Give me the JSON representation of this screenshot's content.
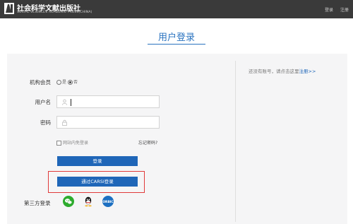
{
  "header": {
    "brand_name": "社会科学文献出版社",
    "brand_sub": "SOCIAL SCIENCES ACADEMIC PRESS(CHINA)",
    "links": [
      "登录",
      "注册"
    ]
  },
  "page": {
    "title": "用户登录"
  },
  "form": {
    "institution_member_label": "机构会员",
    "radio_options": [
      {
        "label": "是",
        "selected": false
      },
      {
        "label": "否",
        "selected": true
      }
    ],
    "username_label": "用户名",
    "password_label": "密码",
    "auto_login_label": "网站内免登录",
    "auto_login_checked": false,
    "forgot_password": "忘记密码?",
    "login_button": "登录",
    "carsi_button": "通过CARSI登录"
  },
  "third_party": {
    "label": "第三方登录",
    "providers": [
      {
        "name": "wechat-icon",
        "color": "#2dab2d"
      },
      {
        "name": "qq-icon",
        "color": "#111111"
      },
      {
        "name": "orcid-icon",
        "color": "#1c6fc1",
        "text": "ORBIC"
      }
    ]
  },
  "register": {
    "prompt": "还没有账号，请点击这里",
    "link": "注册>>"
  },
  "colors": {
    "accent": "#1f66b8",
    "highlight": "#e03a3a",
    "topbar": "#3a3a3a"
  }
}
